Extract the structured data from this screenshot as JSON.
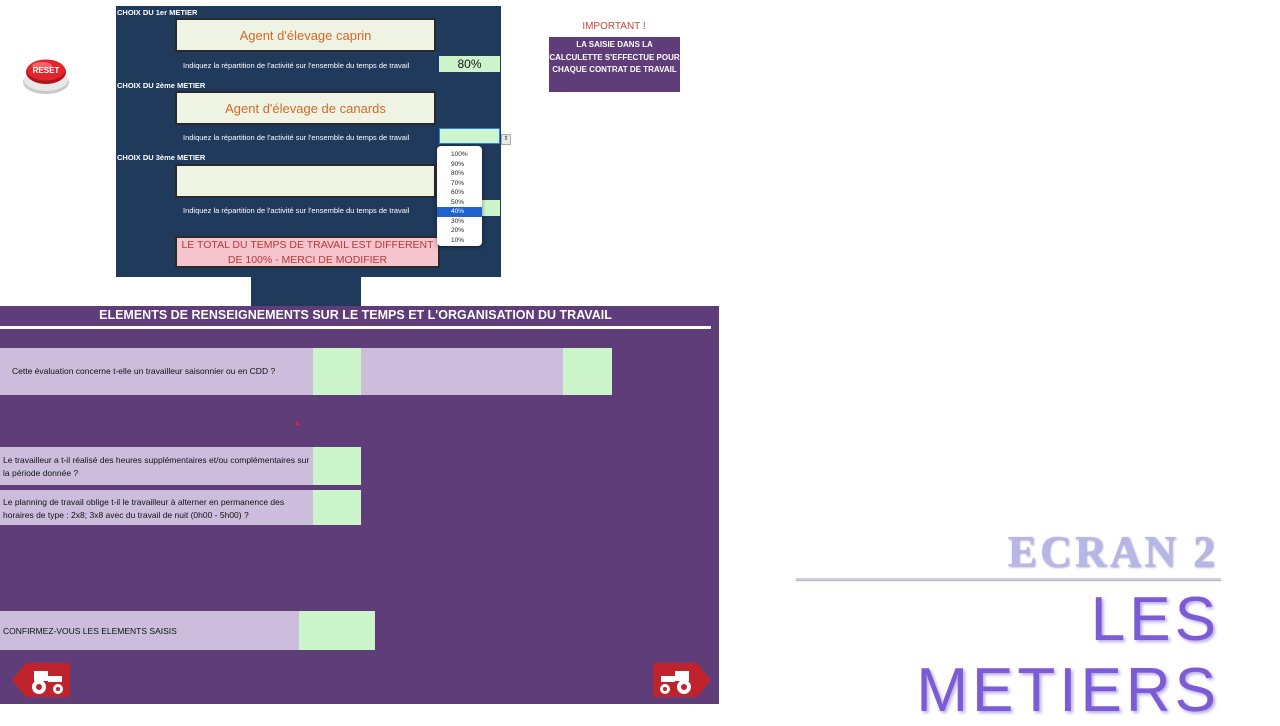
{
  "top_panel": {
    "job1": {
      "section_label": "CHOIX DU 1er METIER",
      "name": "Agent d'élevage caprin",
      "repartition_label": "Indiquez la répartition de l'activité sur l'ensemble du temps de travail",
      "percent": "80%"
    },
    "job2": {
      "section_label": "CHOIX DU 2ème METIER",
      "name": "Agent d'élevage de canards",
      "repartition_label": "Indiquez la répartition de l'activité sur l'ensemble du temps de travail",
      "percent": ""
    },
    "job3": {
      "section_label": "CHOIX DU 3ème METIER",
      "name": "",
      "repartition_label": "Indiquez la répartition de l'activité sur l'ensemble du temps de travail",
      "percent": ""
    },
    "alert": "LE TOTAL DU TEMPS DE TRAVAIL EST DIFFERENT DE 100% - MERCI DE MODIFIER"
  },
  "dropdown": {
    "options": [
      "100%",
      "90%",
      "80%",
      "70%",
      "60%",
      "50%",
      "40%",
      "30%",
      "20%",
      "10%"
    ],
    "selected": "40%"
  },
  "reset_button": {
    "label": "RESET",
    "color": "#d8232a"
  },
  "important": {
    "title": "IMPORTANT !",
    "message": "LA SAISIE DANS LA CALCULETTE S'EFFECTUE POUR CHAQUE CONTRAT DE TRAVAIL"
  },
  "section": {
    "title": "ELEMENTS DE RENSEIGNEMENTS SUR LE TEMPS ET L'ORGANISATION DU TRAVAIL",
    "q1": "Cette évaluation concerne t-elle un travailleur saisonnier ou en CDD  ?",
    "q2": "Le travailleur a t-il réalisé des heures supplémentaires et/ou complémentaires sur la période donnée ?",
    "q3": "Le planning de travail oblige t-il le travailleur à alterner en permanence des horaires de type : 2x8; 3x8 avec du travail de nuit (0h00 - 5h00) ?",
    "confirm": "CONFIRMEZ-VOUS LES ELEMENTS SAISIS"
  },
  "nav": {
    "prev_icon": "tractor-left-arrow-icon",
    "next_icon": "tractor-right-arrow-icon"
  },
  "watermark": {
    "line1": "ECRAN 2",
    "line2": "LES METIERS"
  },
  "colors": {
    "navy": "#1f3a5a",
    "purple": "#5e3d78",
    "input_green": "#ccf5cc",
    "lavender": "#cdbddd",
    "alert_pink": "#f6c4cc"
  }
}
